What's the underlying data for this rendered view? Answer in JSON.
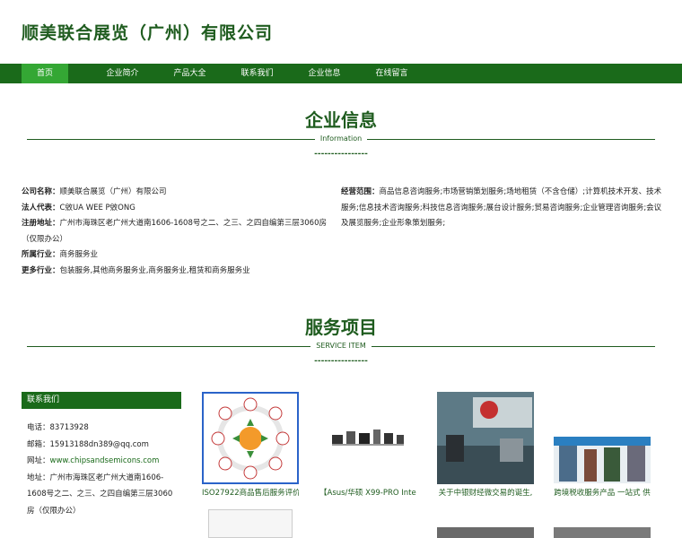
{
  "site": {
    "title": "顺美联合展览（广州）有限公司"
  },
  "nav": {
    "items": [
      "首页",
      "企业简介",
      "产品大全",
      "联系我们",
      "企业信息",
      "在线留言"
    ]
  },
  "info_section": {
    "title": "企业信息",
    "subtitle": "Information",
    "dashes": "----------------"
  },
  "company_info": {
    "name_label": "公司名称：",
    "name": "顺美联合展览（广州）有限公司",
    "rep_label": "法人代表：",
    "rep": "C敓UA WEE P敓ONG",
    "addr_label": "注册地址：",
    "addr": "广州市海珠区老广州大道南1606-1608号之二、之三、之四自编第三层3060房（仅限办公）",
    "industry_label": "所属行业：",
    "industry": "商务服务业",
    "more_label": "更多行业：",
    "more": "包装服务,其他商务服务业,商务服务业,租赁和商务服务业",
    "scope_label": "经营范围：",
    "scope": "商品信息咨询服务;市场营销策划服务;场地租赁（不含仓储）;计算机技术开发、技术服务;信息技术咨询服务;科技信息咨询服务;展台设计服务;贸易咨询服务;企业管理咨询服务;会议及展览服务;企业形象策划服务;"
  },
  "service_section": {
    "title": "服务项目",
    "subtitle": "SERVICE ITEM",
    "dashes": "----------------"
  },
  "contact": {
    "header": "联系我们",
    "phone": "电话：83713928",
    "email": "邮箱：15913188dn389@qq.com",
    "site_label": "网址：",
    "site": "www.chipsandsemicons.com",
    "address": "地址：广州市海珠区老广州大道南1606-1608号之二、之三、之四自编第三层3060房（仅限办公）"
  },
  "products": [
    {
      "caption": "ISO27922商品售后服务评价",
      "icon": "process-diagram-image"
    },
    {
      "caption": "【Asus/华硕 X99-PRO Intel",
      "icon": "hardware-image"
    },
    {
      "caption": "关于中银财经微交易的诞生,",
      "icon": "office-image"
    },
    {
      "caption": "跨境税收服务产品 一站式 供",
      "icon": "exhibition-image"
    }
  ],
  "colors": {
    "brand": "#1a6a1a",
    "active_nav": "#34a734",
    "title": "#1f5c1f"
  }
}
